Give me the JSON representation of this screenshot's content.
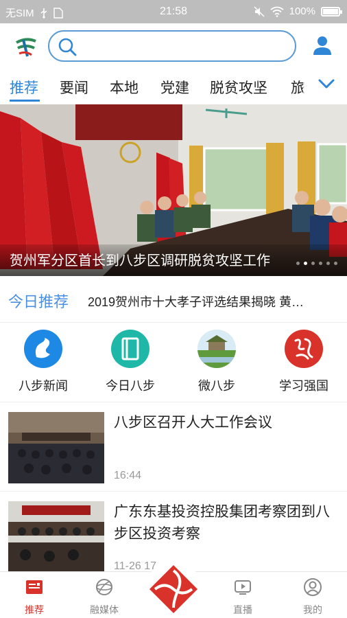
{
  "status_bar": {
    "carrier": "无SIM",
    "time": "21:58",
    "battery_percent": "100%",
    "battery_level": 1.0
  },
  "header": {
    "logo_icon": "babu-logo-icon",
    "search": {
      "placeholder": "",
      "icon": "search-icon"
    },
    "user_icon": "user-icon"
  },
  "tabs": {
    "items": [
      "推荐",
      "要闻",
      "本地",
      "党建",
      "脱贫攻坚",
      "旅"
    ],
    "active_index": 0,
    "expand_icon": "chevron-down-icon",
    "active_color": "#2f86d6"
  },
  "hero": {
    "caption": "贺州军分区首长到八步区调研脱贫攻坚工作",
    "slide_count": 6,
    "active_slide": 1
  },
  "today": {
    "label": "今日推荐",
    "headline": "2019贺州市十大孝子评选结果揭晓 黄…"
  },
  "shortcuts": [
    {
      "label": "八步新闻",
      "icon": "babu-news-icon",
      "color": "#1e88e5"
    },
    {
      "label": "今日八步",
      "icon": "book-icon",
      "color": "#1fb8a8"
    },
    {
      "label": "微八步",
      "icon": "landscape-icon",
      "color": "#7cb342"
    },
    {
      "label": "学习强国",
      "icon": "xuexi-qiangguo-icon",
      "color": "#d9322a"
    }
  ],
  "news": [
    {
      "title": "八步区召开人大工作会议",
      "time": "16:44"
    },
    {
      "title": "广东东基投资控股集团考察团到八步区投资考察",
      "time": "11-26 17"
    }
  ],
  "bottom_nav": {
    "items": [
      {
        "label": "推荐",
        "icon": "news-icon"
      },
      {
        "label": "融媒体",
        "icon": "globe-icon"
      },
      {
        "label": "",
        "icon": "center-logo-icon"
      },
      {
        "label": "直播",
        "icon": "play-icon"
      },
      {
        "label": "我的",
        "icon": "profile-icon"
      }
    ],
    "active_index": 0,
    "active_color": "#d9322a"
  }
}
